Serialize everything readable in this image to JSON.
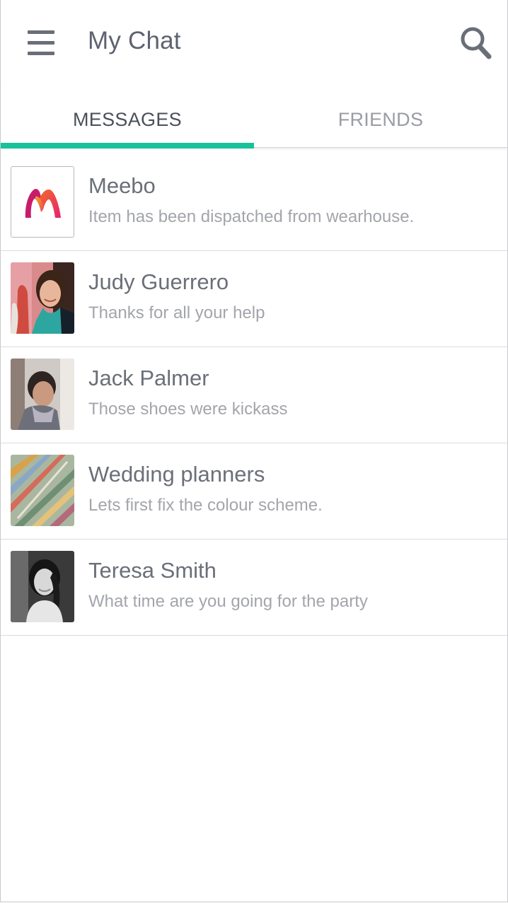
{
  "header": {
    "title": "My Chat",
    "menu_icon": "hamburger-menu-icon",
    "search_icon": "search-icon"
  },
  "tabs": [
    {
      "label": "MESSAGES",
      "active": true
    },
    {
      "label": "FRIENDS",
      "active": false
    }
  ],
  "colors": {
    "accent": "#17c19a",
    "title_text": "#5e6270",
    "name_text": "#6b6f78",
    "preview_text": "#a3a5ab"
  },
  "conversations": [
    {
      "name": "Meebo",
      "preview": "Item has been dispatched from wearhouse.",
      "avatar": "meebo-logo"
    },
    {
      "name": "Judy Guerrero",
      "preview": "Thanks for all your help",
      "avatar": "judy-photo"
    },
    {
      "name": "Jack Palmer",
      "preview": "Those shoes were kickass",
      "avatar": "jack-photo"
    },
    {
      "name": "Wedding planners",
      "preview": "Lets first fix the colour scheme.",
      "avatar": "wedding-photo"
    },
    {
      "name": "Teresa Smith",
      "preview": "What time are you going for the party",
      "avatar": "teresa-photo"
    }
  ]
}
